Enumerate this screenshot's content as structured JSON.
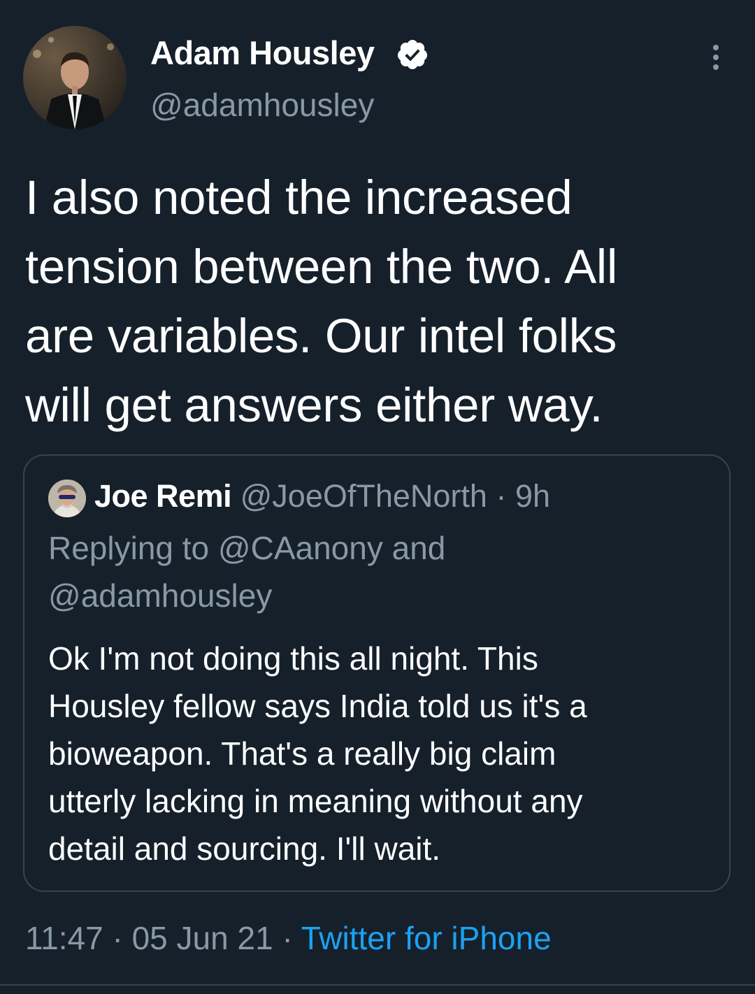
{
  "author": {
    "display_name": "Adam Housley",
    "handle": "@adamhousley",
    "verified_icon": "verified-badge-icon"
  },
  "tweet": {
    "text": "I also noted the increased\ntension between the two. All\nare variables. Our intel folks\nwill get answers either way."
  },
  "quoted": {
    "name": "Joe Remi",
    "handle": "@JoeOfTheNorth",
    "separator": "·",
    "time": "9h",
    "replying_to": "Replying to @CAanony and\n@adamhousley",
    "text": "Ok I'm not doing this all night. This\nHousley fellow says India told us it's a\nbioweapon. That's a really big claim\nutterly lacking in meaning without any\ndetail and sourcing. I'll wait."
  },
  "meta": {
    "time": "11:47",
    "sep1": "·",
    "date": "05 Jun 21",
    "sep2": "·",
    "source": "Twitter for iPhone"
  },
  "colors": {
    "background": "#15202b",
    "secondary_text": "#8899a6",
    "link": "#1da1f2",
    "border": "#38444d"
  },
  "icons": {
    "more": "more-vertical-icon"
  }
}
